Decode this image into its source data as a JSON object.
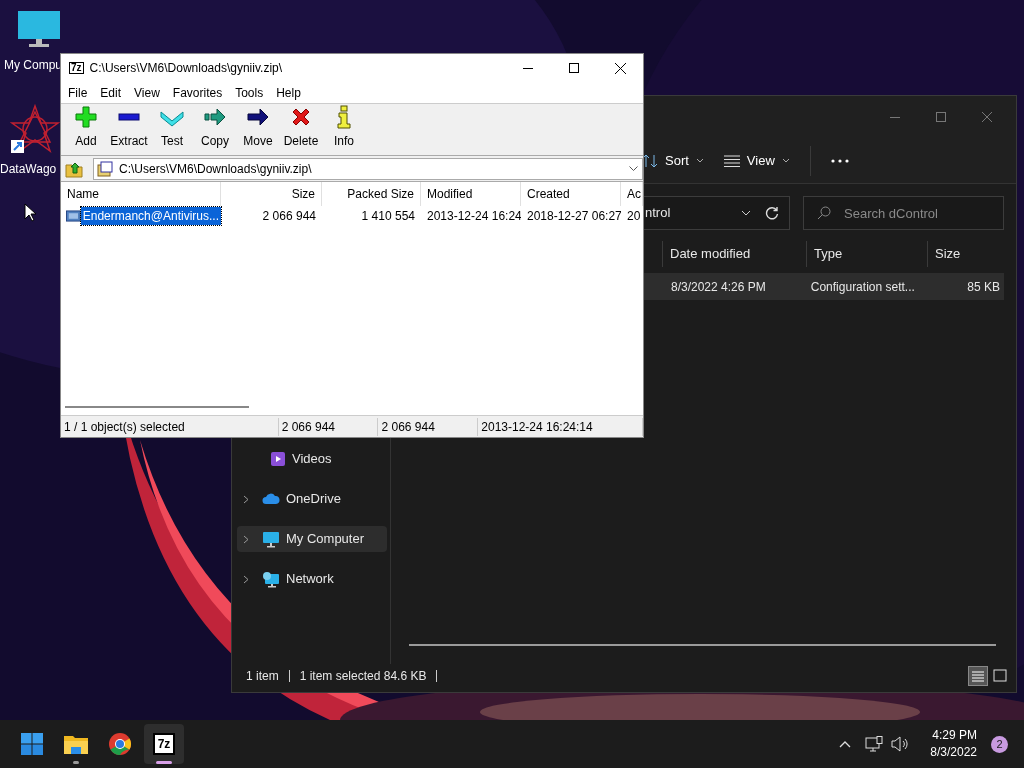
{
  "desktop": {
    "icons": [
      {
        "kind": "monitor",
        "label": "My Compu"
      },
      {
        "kind": "star",
        "label": "DataWago"
      }
    ]
  },
  "archive_window": {
    "logo": "7z",
    "title": "C:\\Users\\VM6\\Downloads\\gyniiv.zip\\",
    "menu": [
      "File",
      "Edit",
      "View",
      "Favorites",
      "Tools",
      "Help"
    ],
    "toolbar": [
      {
        "kind": "add",
        "label": "Add"
      },
      {
        "kind": "extract",
        "label": "Extract"
      },
      {
        "kind": "test",
        "label": "Test"
      },
      {
        "kind": "copy",
        "label": "Copy"
      },
      {
        "kind": "move",
        "label": "Move"
      },
      {
        "kind": "delete",
        "label": "Delete"
      },
      {
        "kind": "info",
        "label": "Info"
      }
    ],
    "address": "C:\\Users\\VM6\\Downloads\\gyniiv.zip\\",
    "columns": [
      "Name",
      "Size",
      "Packed Size",
      "Modified",
      "Created",
      "Ac"
    ],
    "rows": [
      {
        "selected": true,
        "cells": [
          "Endermanch@Antivirus...",
          "2 066 944",
          "1 410 554",
          "2013-12-24 16:24",
          "2018-12-27 06:27",
          "20"
        ]
      }
    ],
    "status": [
      "1 / 1 object(s) selected",
      "2 066 944",
      "2 066 944",
      "2013-12-24 16:24:14"
    ]
  },
  "explorer_window": {
    "toolbar": [
      {
        "kind": "sort",
        "label": "Sort"
      },
      {
        "kind": "view",
        "label": "View"
      }
    ],
    "address": "ntrol",
    "search": {
      "placeholder": "Search dControl"
    },
    "columns": [
      "Date modified",
      "Type",
      "Size"
    ],
    "rows": [
      {
        "selected": true,
        "cells": [
          "8/3/2022 4:26 PM",
          "Configuration sett...",
          "85 KB"
        ]
      }
    ],
    "sidebar": [
      {
        "kind": "videos",
        "label": "Videos",
        "expandable": false,
        "selected": false
      },
      {
        "kind": "cloud",
        "label": "OneDrive",
        "expandable": true,
        "selected": false
      },
      {
        "kind": "computer",
        "label": "My Computer",
        "expandable": true,
        "selected": true
      },
      {
        "kind": "network",
        "label": "Network",
        "expandable": true,
        "selected": false
      }
    ],
    "status": [
      "1 item",
      "1 item selected  84.6 KB"
    ]
  },
  "taskbar": {
    "apps": [
      {
        "kind": "start",
        "running": false,
        "selected": false
      },
      {
        "kind": "folder",
        "running": true,
        "selected": false
      },
      {
        "kind": "browser",
        "running": false,
        "selected": false
      },
      {
        "kind": "archiver",
        "label": "7z",
        "running": true,
        "selected": true
      }
    ],
    "time": "4:29 PM",
    "date": "8/3/2022",
    "badge": "2"
  }
}
